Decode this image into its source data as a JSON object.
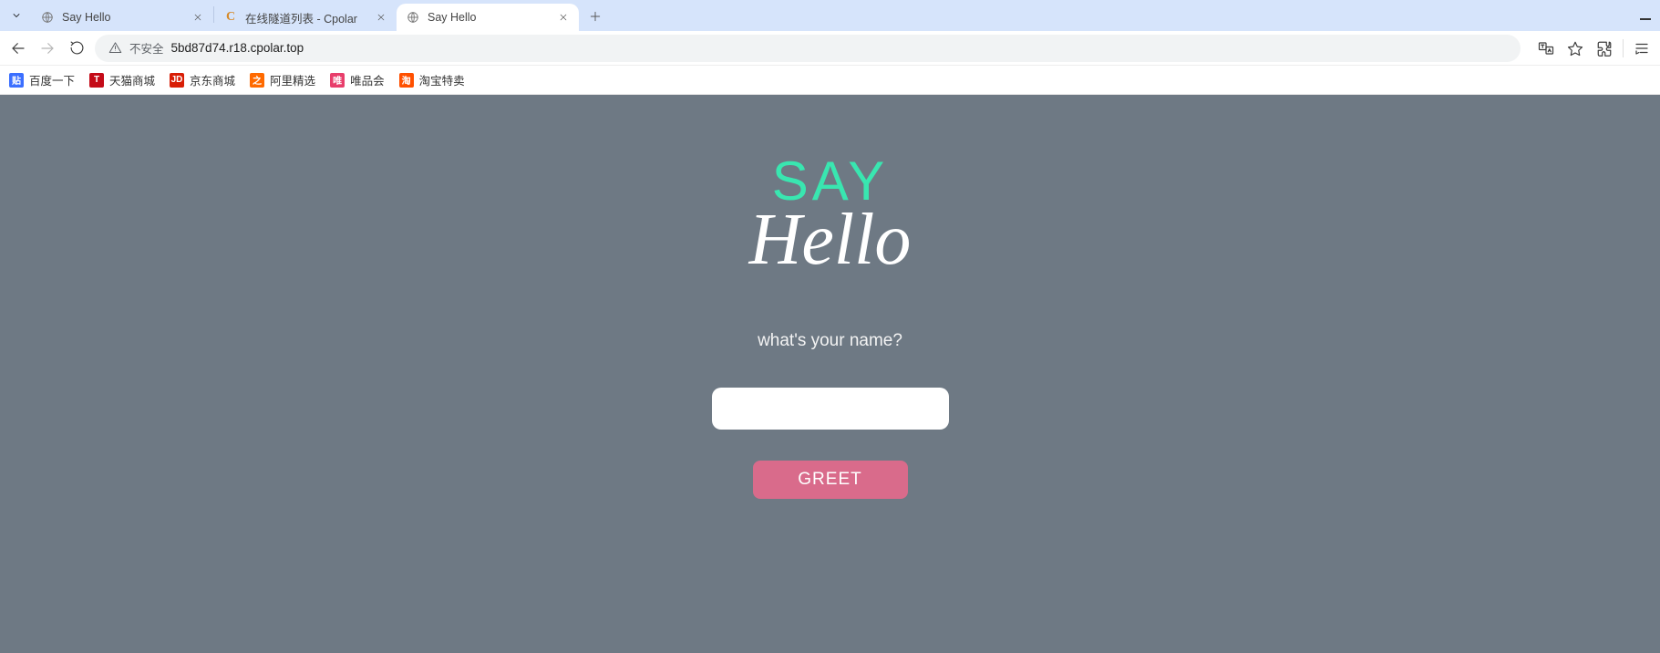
{
  "tabs": {
    "items": [
      {
        "title": "Say Hello",
        "icon": "globe",
        "active": false
      },
      {
        "title": "在线隧道列表 - Cpolar",
        "icon": "cpolar",
        "active": false
      },
      {
        "title": "Say Hello",
        "icon": "globe",
        "active": true
      }
    ]
  },
  "address_bar": {
    "security_label": "不安全",
    "url": "5bd87d74.r18.cpolar.top"
  },
  "bookmarks": [
    {
      "label": "百度一下",
      "color": "#3b6fff",
      "glyph": "贴"
    },
    {
      "label": "天猫商城",
      "color": "#c40b18",
      "glyph": "T"
    },
    {
      "label": "京东商城",
      "color": "#d81e06",
      "glyph": "JD"
    },
    {
      "label": "阿里精选",
      "color": "#ff6a00",
      "glyph": "之"
    },
    {
      "label": "唯品会",
      "color": "#e83e6b",
      "glyph": "唯"
    },
    {
      "label": "淘宝特卖",
      "color": "#ff5000",
      "glyph": "淘"
    }
  ],
  "page": {
    "heading_top": "SAY",
    "heading_cursive": "Hello",
    "prompt": "what's your name?",
    "input_value": "",
    "button_label": "GREET"
  }
}
